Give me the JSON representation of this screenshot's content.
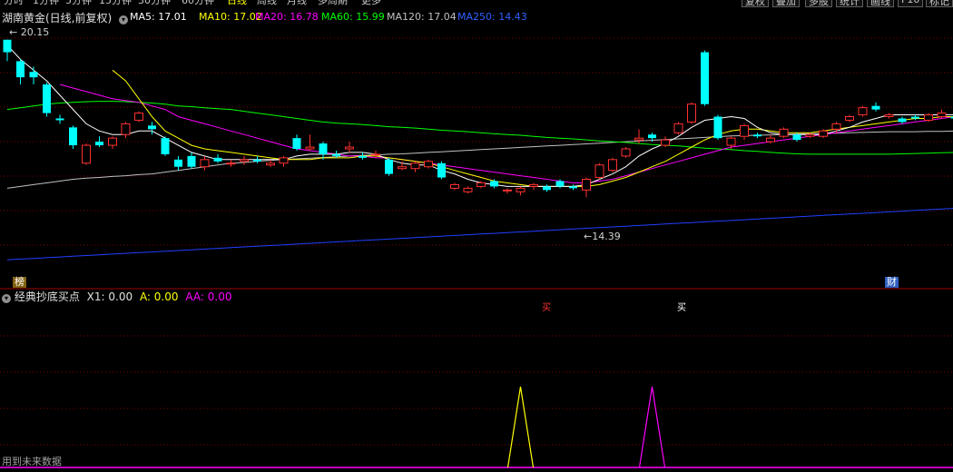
{
  "toolbar": {
    "periods": [
      "分时",
      "1分钟",
      "5分钟",
      "15分钟",
      "30分钟",
      "60分钟",
      "日线",
      "周线",
      "月线",
      "多周期",
      "更多"
    ],
    "selected": "日线",
    "right_buttons": [
      "复权",
      "叠加",
      "多股",
      "统计",
      "画线",
      "F10",
      "标记"
    ]
  },
  "stock": {
    "title": "湖南黄金(日线,前复权)"
  },
  "ma_legend": [
    {
      "label": "MA5: 17.01",
      "color": "#ffffff"
    },
    {
      "label": "MA10: 17.02",
      "color": "#ffff00"
    },
    {
      "label": "MA20: 16.78",
      "color": "#ff00ff"
    },
    {
      "label": "MA60: 15.99",
      "color": "#00ff00"
    },
    {
      "label": "MA120: 17.04",
      "color": "#c0c0c0"
    },
    {
      "label": "MA250: 14.43",
      "color": "#3060ff"
    }
  ],
  "annotations": {
    "high_label": "20.15",
    "low_label": "14.39",
    "left_badge": "榜",
    "right_badge": "财"
  },
  "indicator": {
    "title": "经典抄底买点",
    "x1": "X1: 0.00",
    "a": "A: 0.00",
    "aa": "AA: 0.00",
    "marker1": "买",
    "marker2": "买",
    "footer": "用到未来数据"
  },
  "colors": {
    "up": "#ff3030",
    "down": "#00ffff",
    "ma5": "#ffffff",
    "ma10": "#ffff00",
    "ma20": "#ff00ff",
    "ma60": "#00ff00",
    "ma120": "#c0c0c0",
    "ma250": "#2040ff",
    "grid": "#800000"
  },
  "chart_data": {
    "type": "candlestick",
    "price_range": [
      13.6,
      20.6
    ],
    "candles": [
      [
        20.15,
        19.8,
        20.15,
        19.55
      ],
      [
        19.55,
        19.1,
        19.6,
        18.9
      ],
      [
        19.25,
        19.1,
        19.4,
        18.9
      ],
      [
        18.9,
        18.1,
        18.95,
        18.0
      ],
      [
        17.95,
        17.9,
        18.05,
        17.8
      ],
      [
        17.7,
        17.2,
        17.75,
        17.1
      ],
      [
        16.7,
        17.2,
        17.25,
        16.65
      ],
      [
        17.3,
        17.2,
        17.45,
        17.15
      ],
      [
        17.2,
        17.4,
        17.45,
        17.1
      ],
      [
        17.5,
        17.8,
        17.85,
        17.4
      ],
      [
        17.9,
        18.1,
        18.15,
        17.85
      ],
      [
        17.75,
        17.65,
        17.85,
        17.5
      ],
      [
        17.4,
        16.95,
        17.45,
        16.9
      ],
      [
        16.8,
        16.6,
        16.9,
        16.5
      ],
      [
        16.9,
        16.6,
        17.0,
        16.55
      ],
      [
        16.6,
        16.8,
        16.9,
        16.5
      ],
      [
        16.85,
        16.75,
        16.95,
        16.7
      ],
      [
        16.7,
        16.7,
        16.8,
        16.6
      ],
      [
        16.75,
        16.8,
        16.9,
        16.65
      ],
      [
        16.8,
        16.75,
        16.9,
        16.7
      ],
      [
        16.65,
        16.7,
        16.8,
        16.6
      ],
      [
        16.7,
        16.85,
        16.9,
        16.6
      ],
      [
        17.4,
        17.1,
        17.5,
        17.05
      ],
      [
        17.1,
        17.15,
        17.5,
        17.05
      ],
      [
        17.25,
        16.95,
        17.3,
        16.8
      ],
      [
        16.95,
        16.9,
        17.05,
        16.85
      ],
      [
        17.1,
        17.15,
        17.3,
        17.0
      ],
      [
        16.9,
        16.85,
        17.0,
        16.8
      ],
      [
        16.95,
        16.95,
        17.05,
        16.85
      ],
      [
        16.8,
        16.4,
        16.85,
        16.35
      ],
      [
        16.55,
        16.6,
        16.75,
        16.5
      ],
      [
        16.55,
        16.7,
        16.75,
        16.45
      ],
      [
        16.6,
        16.75,
        16.8,
        16.55
      ],
      [
        16.7,
        16.3,
        16.75,
        16.25
      ],
      [
        16.0,
        16.1,
        16.15,
        15.95
      ],
      [
        15.9,
        16.0,
        16.05,
        15.85
      ],
      [
        16.05,
        16.15,
        16.2,
        16.0
      ],
      [
        16.2,
        16.05,
        16.25,
        16.0
      ],
      [
        15.95,
        15.95,
        16.0,
        15.85
      ],
      [
        15.9,
        16.0,
        16.05,
        15.8
      ],
      [
        16.05,
        16.1,
        16.15,
        15.95
      ],
      [
        16.05,
        15.95,
        16.1,
        15.9
      ],
      [
        16.2,
        16.05,
        16.25,
        16.0
      ],
      [
        16.05,
        16.0,
        16.1,
        15.95
      ],
      [
        15.95,
        16.25,
        16.3,
        15.75
      ],
      [
        16.3,
        16.65,
        16.7,
        16.25
      ],
      [
        16.5,
        16.8,
        16.85,
        16.45
      ],
      [
        16.9,
        17.1,
        17.15,
        16.85
      ],
      [
        17.35,
        17.4,
        17.65,
        17.25
      ],
      [
        17.5,
        17.4,
        17.55,
        17.3
      ],
      [
        17.2,
        17.35,
        17.45,
        17.15
      ],
      [
        17.55,
        17.8,
        17.85,
        17.5
      ],
      [
        17.85,
        18.35,
        18.4,
        17.8
      ],
      [
        19.8,
        18.35,
        19.85,
        18.3
      ],
      [
        18.0,
        17.4,
        18.05,
        17.35
      ],
      [
        17.2,
        17.4,
        17.45,
        17.1
      ],
      [
        17.45,
        17.75,
        17.8,
        17.35
      ],
      [
        17.5,
        17.45,
        17.55,
        17.4
      ],
      [
        17.3,
        17.4,
        17.5,
        17.25
      ],
      [
        17.45,
        17.65,
        17.7,
        17.4
      ],
      [
        17.5,
        17.35,
        17.55,
        17.3
      ],
      [
        17.45,
        17.5,
        17.55,
        17.4
      ],
      [
        17.45,
        17.6,
        17.65,
        17.4
      ],
      [
        17.65,
        17.8,
        17.85,
        17.55
      ],
      [
        17.9,
        18.0,
        18.05,
        17.85
      ],
      [
        18.05,
        18.25,
        18.3,
        18.0
      ],
      [
        18.3,
        18.2,
        18.4,
        18.15
      ],
      [
        18.0,
        18.05,
        18.1,
        17.95
      ],
      [
        17.95,
        17.85,
        18.0,
        17.8
      ],
      [
        18.0,
        17.95,
        18.05,
        17.9
      ],
      [
        17.9,
        18.05,
        18.1,
        17.85
      ],
      [
        18.0,
        18.1,
        18.2,
        17.95
      ],
      [
        18.0,
        17.95,
        18.1,
        17.9
      ],
      [
        18.0,
        18.2,
        18.7,
        17.6
      ]
    ],
    "ma5": [
      20.0,
      19.6,
      19.3,
      19.0,
      18.6,
      18.2,
      17.8,
      17.6,
      17.5,
      17.5,
      17.6,
      17.6,
      17.4,
      17.2,
      17.0,
      16.9,
      16.8,
      16.8,
      16.8,
      16.8,
      16.8,
      16.8,
      16.9,
      16.95,
      16.95,
      16.95,
      17.0,
      17.0,
      16.95,
      16.8,
      16.7,
      16.65,
      16.65,
      16.5,
      16.4,
      16.25,
      16.15,
      16.1,
      16.05,
      16.05,
      16.05,
      16.05,
      16.05,
      16.05,
      16.1,
      16.25,
      16.4,
      16.6,
      16.9,
      17.1,
      17.25,
      17.45,
      17.7,
      17.9,
      17.95,
      18.0,
      17.95,
      17.7,
      17.55,
      17.5,
      17.5,
      17.5,
      17.5,
      17.6,
      17.7,
      17.85,
      17.95,
      18.05,
      18.05,
      18.05,
      18.05,
      18.05,
      18.05,
      18.05
    ],
    "ma10": [
      null,
      null,
      null,
      null,
      null,
      null,
      null,
      null,
      19.3,
      19.0,
      18.5,
      18.0,
      17.6,
      17.4,
      17.2,
      17.1,
      17.05,
      17.0,
      16.95,
      16.9,
      16.85,
      16.8,
      16.8,
      16.8,
      16.85,
      16.85,
      16.85,
      16.9,
      16.9,
      16.85,
      16.8,
      16.75,
      16.7,
      16.6,
      16.5,
      16.4,
      16.3,
      16.2,
      16.15,
      16.1,
      16.05,
      16.05,
      16.05,
      16.05,
      16.05,
      16.1,
      16.2,
      16.3,
      16.45,
      16.6,
      16.75,
      16.95,
      17.15,
      17.35,
      17.5,
      17.6,
      17.65,
      17.65,
      17.6,
      17.55,
      17.55,
      17.55,
      17.6,
      17.65,
      17.7,
      17.75,
      17.8,
      17.85,
      17.9,
      17.95,
      17.95,
      18.0,
      18.0,
      18.0
    ],
    "ma20": [
      null,
      null,
      null,
      null,
      18.9,
      18.8,
      18.7,
      18.6,
      18.5,
      18.45,
      18.4,
      18.3,
      18.2,
      18.0,
      17.9,
      17.8,
      17.7,
      17.6,
      17.5,
      17.4,
      17.3,
      17.2,
      17.1,
      17.05,
      17.0,
      16.95,
      16.9,
      16.9,
      16.85,
      16.85,
      16.8,
      16.75,
      16.7,
      16.65,
      16.6,
      16.55,
      16.5,
      16.45,
      16.4,
      16.35,
      16.3,
      16.25,
      16.2,
      16.15,
      16.15,
      16.2,
      16.25,
      16.35,
      16.45,
      16.55,
      16.65,
      16.75,
      16.85,
      16.95,
      17.05,
      17.15,
      17.2,
      17.25,
      17.3,
      17.35,
      17.4,
      17.45,
      17.5,
      17.55,
      17.6,
      17.65,
      17.7,
      17.75,
      17.8,
      17.85,
      17.9,
      17.95,
      18.0,
      18.0
    ],
    "ma60": [
      18.2,
      18.25,
      18.3,
      18.35,
      18.38,
      18.4,
      18.42,
      18.43,
      18.43,
      18.42,
      18.4,
      18.38,
      18.35,
      18.3,
      18.28,
      18.25,
      18.22,
      18.2,
      18.15,
      18.1,
      18.05,
      18.0,
      17.95,
      17.9,
      17.85,
      17.82,
      17.8,
      17.78,
      17.75,
      17.72,
      17.7,
      17.68,
      17.65,
      17.62,
      17.6,
      17.58,
      17.55,
      17.52,
      17.5,
      17.48,
      17.45,
      17.42,
      17.4,
      17.38,
      17.35,
      17.32,
      17.3,
      17.28,
      17.25,
      17.22,
      17.2,
      17.18,
      17.15,
      17.12,
      17.1,
      17.08,
      17.05,
      17.03,
      17.0,
      16.98,
      16.96,
      16.95,
      16.95,
      16.95,
      16.95,
      16.95,
      16.95,
      16.95,
      16.96,
      16.97,
      16.98,
      16.99,
      17.0,
      17.0
    ],
    "ma120": [
      16.0,
      16.05,
      16.1,
      16.15,
      16.2,
      16.25,
      16.28,
      16.3,
      16.33,
      16.35,
      16.38,
      16.4,
      16.45,
      16.5,
      16.55,
      16.6,
      16.65,
      16.7,
      16.72,
      16.75,
      16.78,
      16.8,
      16.82,
      16.84,
      16.86,
      16.88,
      16.9,
      16.92,
      16.93,
      16.95,
      16.96,
      16.98,
      17.0,
      17.02,
      17.04,
      17.06,
      17.08,
      17.1,
      17.12,
      17.14,
      17.16,
      17.18,
      17.2,
      17.22,
      17.24,
      17.26,
      17.28,
      17.3,
      17.32,
      17.34,
      17.36,
      17.38,
      17.4,
      17.42,
      17.44,
      17.46,
      17.47,
      17.48,
      17.49,
      17.5,
      17.51,
      17.52,
      17.53,
      17.54,
      17.55,
      17.56,
      17.57,
      17.58,
      17.58,
      17.58,
      17.59,
      17.59,
      17.6,
      17.6
    ],
    "ma250": [
      14.0,
      14.02,
      14.04,
      14.06,
      14.08,
      14.1,
      14.12,
      14.14,
      14.16,
      14.18,
      14.2,
      14.22,
      14.24,
      14.26,
      14.28,
      14.3,
      14.32,
      14.34,
      14.36,
      14.38,
      14.4,
      14.42,
      14.44,
      14.46,
      14.48,
      14.5,
      14.52,
      14.54,
      14.56,
      14.58,
      14.6,
      14.62,
      14.64,
      14.66,
      14.68,
      14.7,
      14.72,
      14.74,
      14.76,
      14.78,
      14.8,
      14.82,
      14.84,
      14.86,
      14.88,
      14.9,
      14.92,
      14.94,
      14.96,
      14.98,
      15.0,
      15.02,
      15.04,
      15.06,
      15.08,
      15.1,
      15.12,
      15.14,
      15.16,
      15.18,
      15.2,
      15.22,
      15.24,
      15.26,
      15.28,
      15.3,
      15.32,
      15.34,
      15.36,
      15.38,
      15.4,
      15.42,
      15.44,
      15.46
    ],
    "signals": [
      {
        "index": 39,
        "value": 1,
        "color": "#ffff00"
      },
      {
        "index": 49,
        "value": 1,
        "color": "#ff00ff"
      }
    ],
    "high_index": 0,
    "low_index": 44
  }
}
